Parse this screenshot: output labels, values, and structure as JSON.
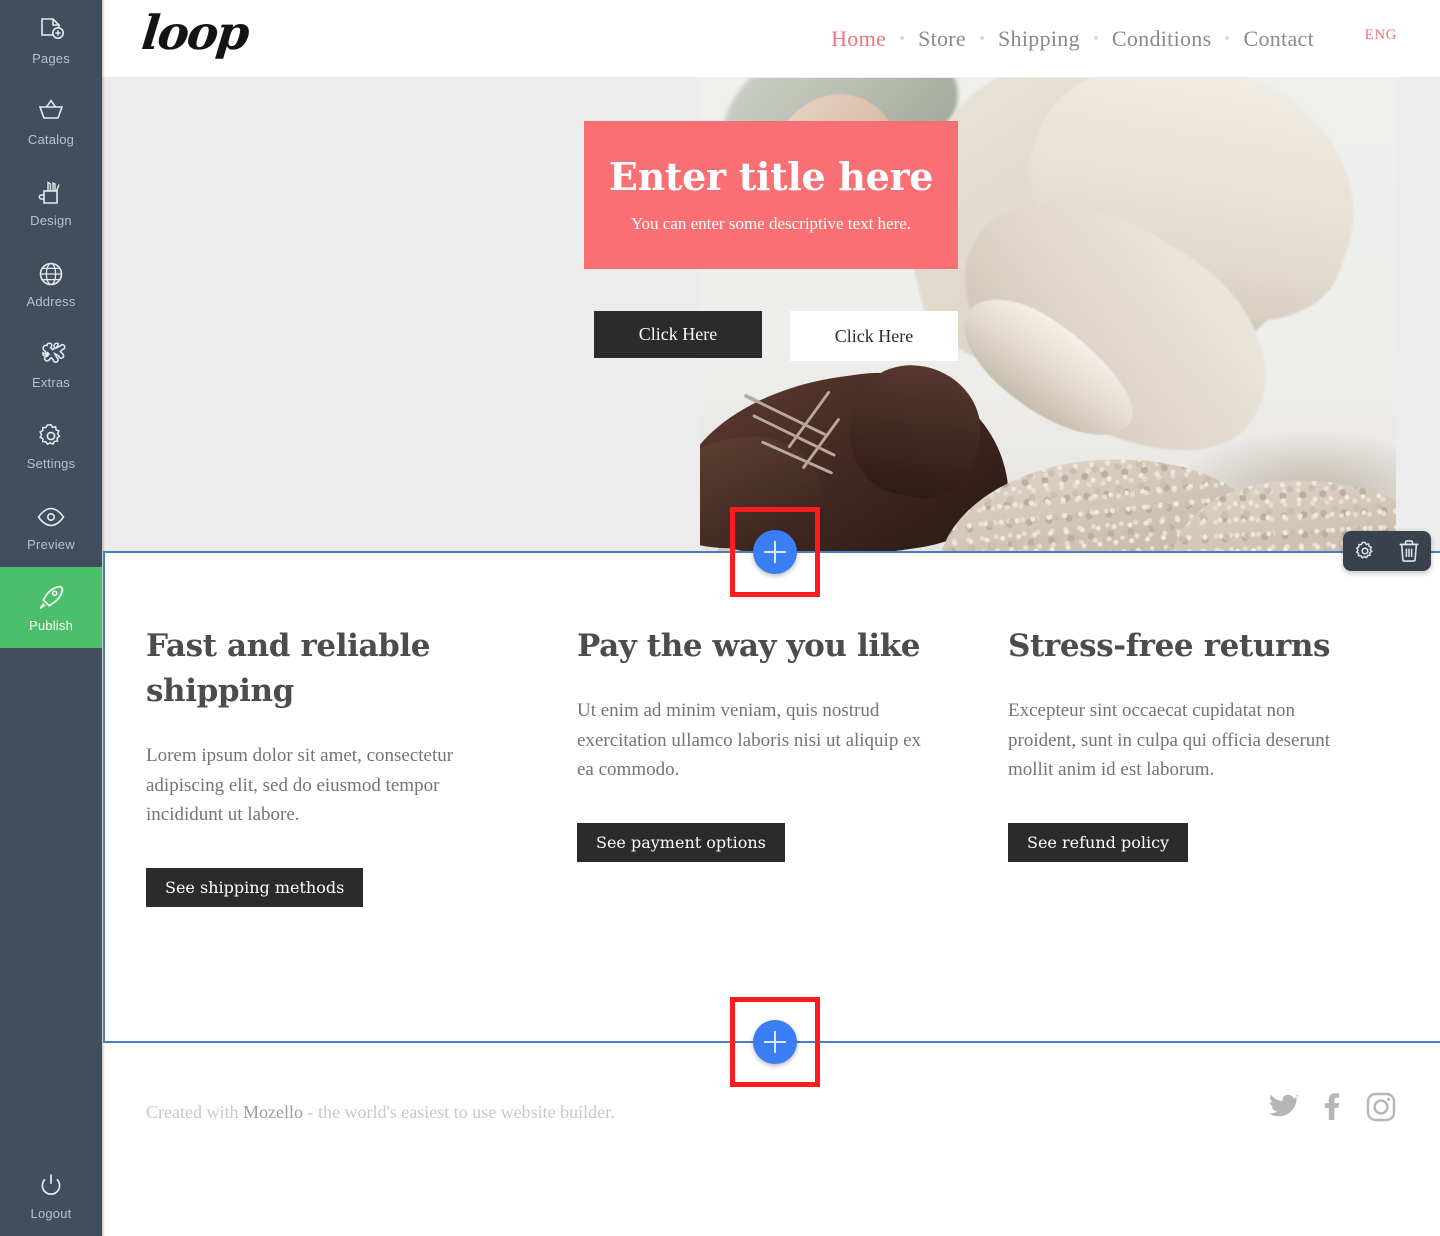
{
  "editor": {
    "sidebar": {
      "items": [
        {
          "label": "Pages",
          "icon": "page-add-icon",
          "active": false
        },
        {
          "label": "Catalog",
          "icon": "basket-icon",
          "active": false
        },
        {
          "label": "Design",
          "icon": "design-cup-icon",
          "active": false
        },
        {
          "label": "Address",
          "icon": "globe-icon",
          "active": false
        },
        {
          "label": "Extras",
          "icon": "puzzle-icon",
          "active": false
        },
        {
          "label": "Settings",
          "icon": "gear-icon",
          "active": false
        },
        {
          "label": "Preview",
          "icon": "eye-icon",
          "active": false
        },
        {
          "label": "Publish",
          "icon": "rocket-icon",
          "active": true
        }
      ],
      "logout": {
        "label": "Logout",
        "icon": "power-icon"
      }
    },
    "section_toolbar": {
      "settings_icon": "gear-icon",
      "delete_icon": "trash-icon"
    },
    "add_section_buttons": [
      {
        "name": "add-section-top",
        "icon": "plus-icon",
        "highlighted": true
      },
      {
        "name": "add-section-bottom",
        "icon": "plus-icon",
        "highlighted": true
      }
    ],
    "colors": {
      "sidebar_bg": "#414e5e",
      "publish_green": "#4cbf6a",
      "selection_blue": "#4a7ec4",
      "add_button_blue": "#3b7df4",
      "highlight_red": "#f91d1d",
      "toolbar_dark": "#39414d"
    }
  },
  "site": {
    "logo": "loop",
    "nav": [
      {
        "label": "Home",
        "active": true
      },
      {
        "label": "Store",
        "active": false
      },
      {
        "label": "Shipping",
        "active": false
      },
      {
        "label": "Conditions",
        "active": false
      },
      {
        "label": "Contact",
        "active": false
      }
    ],
    "language": "ENG",
    "accent_color": "#f4737b",
    "hero": {
      "title": "Enter title here",
      "subtitle": "You can enter some descriptive text here.",
      "title_block_color": "#fa6f74",
      "buttons": [
        {
          "label": "Click Here",
          "style": "dark"
        },
        {
          "label": "Click Here",
          "style": "light"
        }
      ],
      "image_alt": "person sitting on rocks wearing brown leather shoes and beige trousers"
    },
    "features": [
      {
        "heading": "Fast and reliable shipping",
        "body": "Lorem ipsum dolor sit amet, consectetur adipiscing elit, sed do eiusmod tempor incididunt ut labore.",
        "button": "See shipping methods"
      },
      {
        "heading": "Pay the way you like",
        "body": "Ut enim ad minim veniam, quis nostrud exercitation ullamco laboris nisi ut aliquip ex ea commodo.",
        "button": "See payment options"
      },
      {
        "heading": "Stress-free returns",
        "body": "Excepteur sint occaecat cupidatat non proident, sunt in culpa qui officia deserunt mollit anim id est laborum.",
        "button": "See refund policy"
      }
    ],
    "footer": {
      "prefix": "Created with ",
      "brand": "Mozello",
      "suffix": " - the world's easiest to use website builder.",
      "social": [
        {
          "name": "twitter-icon"
        },
        {
          "name": "facebook-icon"
        },
        {
          "name": "instagram-icon"
        }
      ]
    }
  }
}
